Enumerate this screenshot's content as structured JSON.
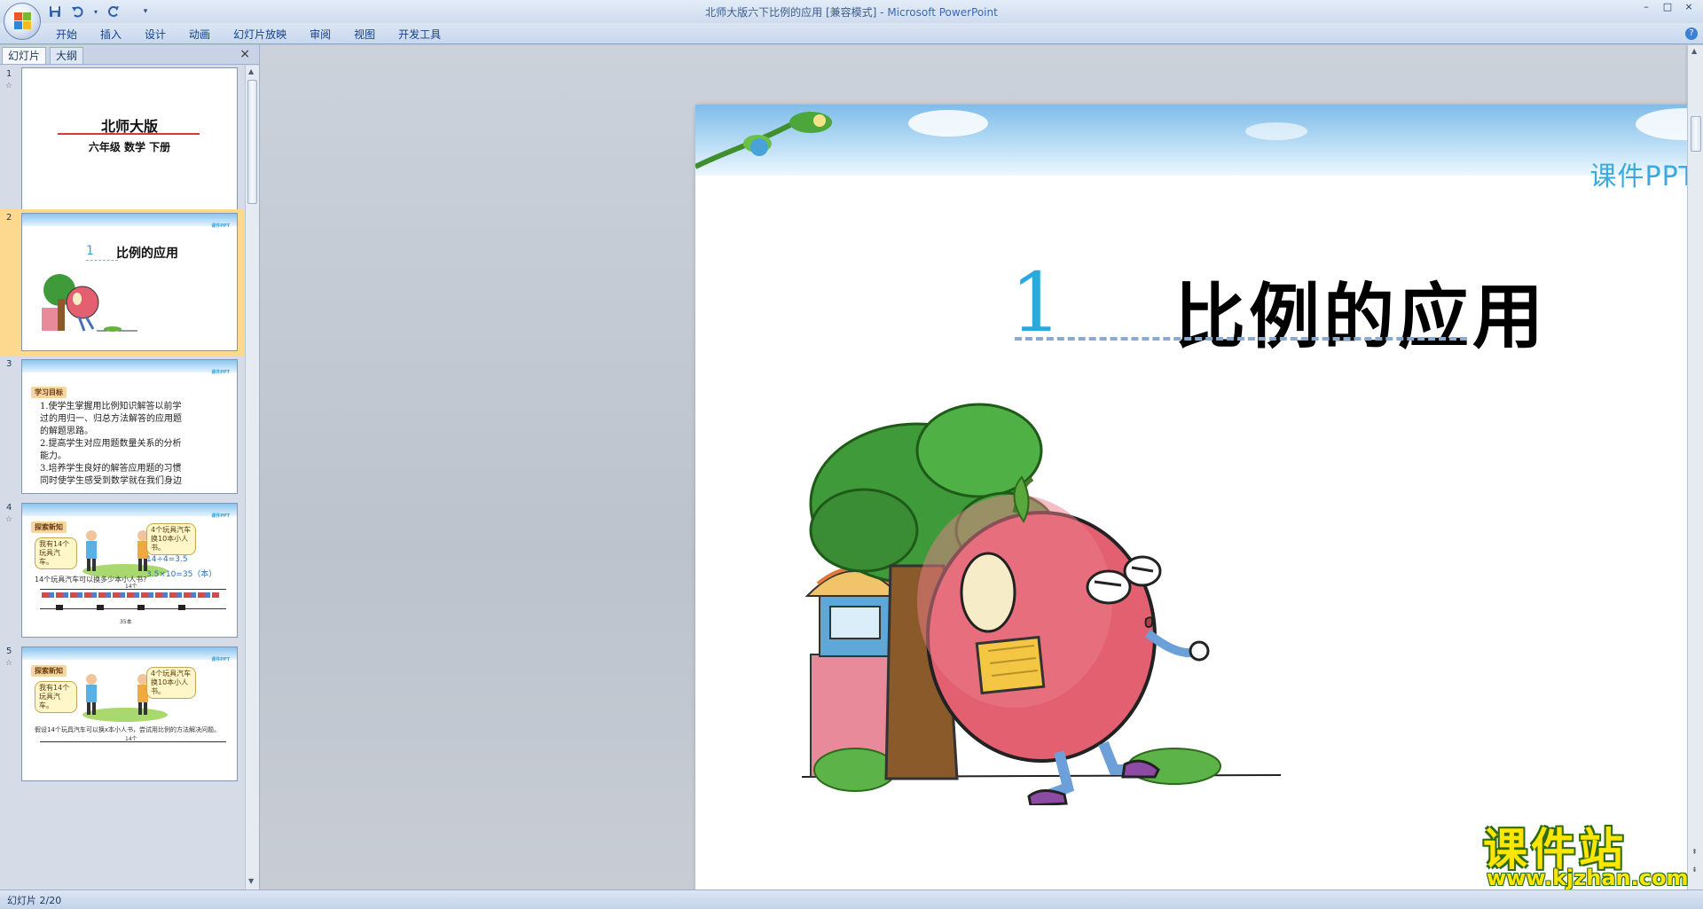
{
  "window": {
    "title_doc": "北师大版六下比例的应用 [兼容模式] - ",
    "title_app": "Microsoft PowerPoint",
    "controls": [
      "–",
      "□",
      "×"
    ]
  },
  "qat": {
    "save_icon": "save-icon",
    "undo_icon": "undo-icon",
    "redo_icon": "redo-icon",
    "customize_icon": "customize-qat-icon"
  },
  "ribbon": {
    "tabs": [
      "开始",
      "插入",
      "设计",
      "动画",
      "幻灯片放映",
      "审阅",
      "视图",
      "开发工具"
    ],
    "help": "?"
  },
  "panel": {
    "tab_slides": "幻灯片",
    "tab_outline": "大纲",
    "close": "×"
  },
  "thumbnails": [
    {
      "num": "1",
      "title": "北师大版",
      "subtitle": "六年级  数学  下册"
    },
    {
      "num": "2",
      "badge": "课件PPT",
      "number": "1",
      "title": "比例的应用"
    },
    {
      "num": "3",
      "badge": "课件PPT",
      "sticker": "学习目标",
      "lines": [
        "1.使学生掌握用比例知识解答以前学",
        "过的用归一、归总方法解答的应用题",
        "的解题思路。",
        "2.提高学生对应用题数量关系的分析",
        "能力。",
        "3.培养学生良好的解答应用题的习惯",
        "同时使学生感受到数学就在我们身边"
      ]
    },
    {
      "num": "4",
      "badge": "课件PPT",
      "sticker": "探索新知",
      "bubble_left": "我有14个玩具汽车。",
      "bubble_right": "4个玩具汽车换10本小人书。",
      "eq1": "14÷4=3.5",
      "eq2": "3.5×10=35（本）",
      "question": "14个玩具汽车可以换多少本小人书?",
      "top_label": "14个",
      "bottom_label": "35本"
    },
    {
      "num": "5",
      "badge": "课件PPT",
      "sticker": "探索新知",
      "bubble_left": "我有14个玩具汽车。",
      "bubble_right": "4个玩具汽车换10本小人书。",
      "question": "假设14个玩具汽车可以换x本小人书，尝试用比例的方法解决问题。",
      "top_label": "14个"
    }
  ],
  "slide": {
    "badge": "课件PPT",
    "number": "1",
    "title": "比例的应用"
  },
  "watermark": {
    "title": "课件站",
    "url": "www.kjzhan.com"
  },
  "status": {
    "text": "幻灯片 2/20"
  },
  "colors": {
    "accent_blue": "#2aa8df",
    "selection": "#fcd98e",
    "watermark_yellow": "#ffe600"
  }
}
